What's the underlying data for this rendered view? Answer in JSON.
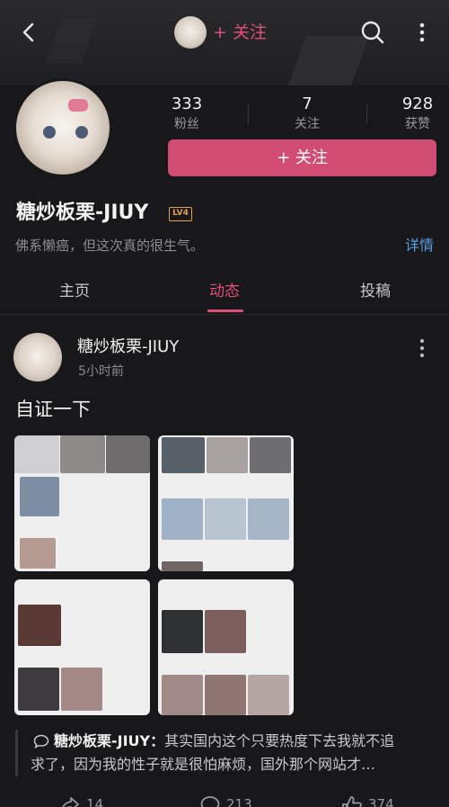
{
  "header": {
    "follow_label": "+ 关注",
    "icons": [
      "back-arrow-icon",
      "search-icon",
      "more-vertical-icon"
    ]
  },
  "profile": {
    "stats": [
      {
        "value": "333",
        "label": "粉丝"
      },
      {
        "value": "7",
        "label": "关注"
      },
      {
        "value": "928",
        "label": "获赞"
      }
    ],
    "follow_button": "+ 关注",
    "username": "糖炒板栗-JIUY",
    "level_badge": "LV4",
    "bio": "佛系懒癌，但这次真的很生气。",
    "detail_link": "详情"
  },
  "tabs": [
    {
      "label": "主页",
      "active": false
    },
    {
      "label": "动态",
      "active": true
    },
    {
      "label": "投稿",
      "active": false
    }
  ],
  "post": {
    "author": "糖炒板栗-JIUY",
    "time": "5小时前",
    "text": "自证一下",
    "comment": {
      "author": "糖炒板栗-JIUY：",
      "line1": "其实国内这个只要热度下去我就不追",
      "line2": "求了，因为我的性子就是很怕麻烦，国外那个网站才…"
    },
    "actions": [
      {
        "icon": "share-icon",
        "count": "14"
      },
      {
        "icon": "comment-icon",
        "count": "213"
      },
      {
        "icon": "like-icon",
        "count": "374"
      }
    ]
  },
  "colors": {
    "accent": "#e0517a",
    "follow_button_bg": "#d24d73",
    "link": "#5aa0e6",
    "background": "#18181a"
  }
}
